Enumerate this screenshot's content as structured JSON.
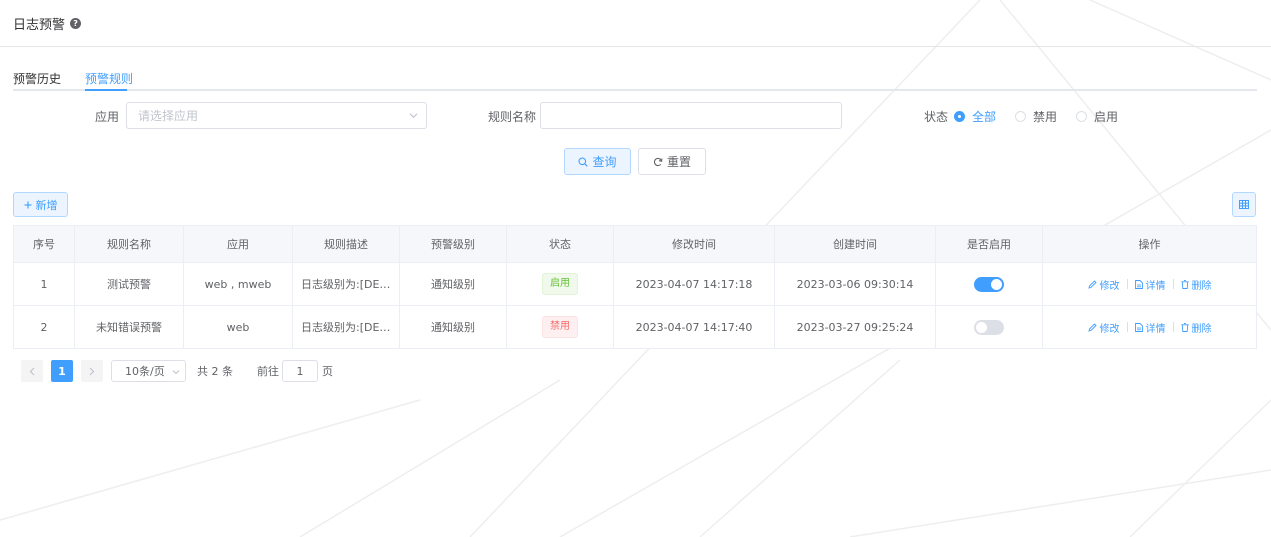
{
  "header": {
    "title": "日志预警",
    "help_icon": "question-circle-icon"
  },
  "tabs": [
    {
      "label": "预警历史",
      "active": false
    },
    {
      "label": "预警规则",
      "active": true
    }
  ],
  "filters": {
    "app_label": "应用",
    "app_placeholder": "请选择应用",
    "rule_name_label": "规则名称",
    "rule_name_value": "",
    "status_label": "状态",
    "status_options": [
      {
        "label": "全部",
        "checked": true
      },
      {
        "label": "禁用",
        "checked": false
      },
      {
        "label": "启用",
        "checked": false
      }
    ]
  },
  "actions": {
    "query_label": "查询",
    "reset_label": "重置",
    "add_label": "新增",
    "columns_icon": "table-columns-icon"
  },
  "table": {
    "columns": [
      "序号",
      "规则名称",
      "应用",
      "规则描述",
      "预警级别",
      "状态",
      "修改时间",
      "创建时间",
      "是否启用",
      "操作"
    ],
    "rows": [
      {
        "index": "1",
        "name": "测试预警",
        "app": "web , mweb",
        "description": "日志级别为:[DEBUG]",
        "level": "通知级别",
        "status": "启用",
        "status_type": "enabled",
        "modified": "2023-04-07 14:17:18",
        "created": "2023-03-06 09:30:14",
        "enabled": true,
        "ops": {
          "edit": "修改",
          "detail": "详情",
          "delete": "删除"
        }
      },
      {
        "index": "2",
        "name": "未知错误预警",
        "app": "web",
        "description": "日志级别为:[DEBUG]",
        "level": "通知级别",
        "status": "禁用",
        "status_type": "disabled",
        "modified": "2023-04-07 14:17:40",
        "created": "2023-03-27 09:25:24",
        "enabled": false,
        "ops": {
          "edit": "修改",
          "detail": "详情",
          "delete": "删除"
        }
      }
    ]
  },
  "pagination": {
    "current_page": "1",
    "page_size": "10条/页",
    "total": "共 2 条",
    "goto_label": "前往",
    "goto_value": "1",
    "goto_unit": "页"
  },
  "colors": {
    "primary": "#409eff",
    "success": "#67c23a",
    "danger": "#f56c6c",
    "border": "#dcdfe6"
  }
}
